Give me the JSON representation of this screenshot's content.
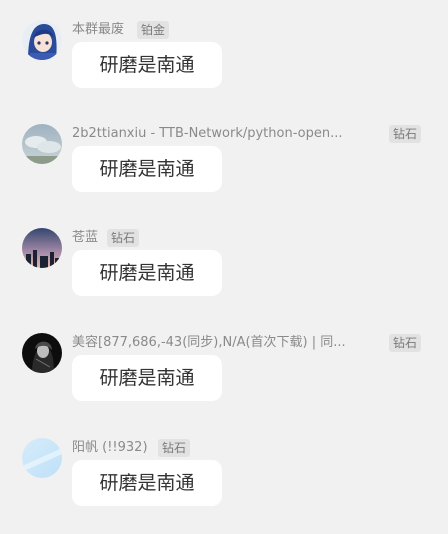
{
  "messages": [
    {
      "sender": "本群最废",
      "badge": "铂金",
      "text": "研磨是南通",
      "avatar_icon": "anime-girl-avatar"
    },
    {
      "sender": "2b2ttianxiu - TTB-Network/python-open...",
      "badge": "钻石",
      "text": "研磨是南通",
      "avatar_icon": "sky-clouds-avatar"
    },
    {
      "sender": "苍蓝",
      "badge": "钻石",
      "text": "研磨是南通",
      "avatar_icon": "dusk-skyline-avatar"
    },
    {
      "sender": "美容[877,686,-43(同步),N/A(首次下载) | 同...",
      "badge": "钻石",
      "text": "研磨是南通",
      "avatar_icon": "dark-portrait-avatar"
    },
    {
      "sender": "阳帆 (!!932)",
      "badge": "钻石",
      "text": "研磨是南通",
      "avatar_icon": "light-blue-avatar"
    }
  ],
  "colors": {
    "background": "#f1f1f1",
    "bubble": "#ffffff",
    "badge_bg": "#e2e2e2",
    "name_text": "#8a8a8a"
  }
}
